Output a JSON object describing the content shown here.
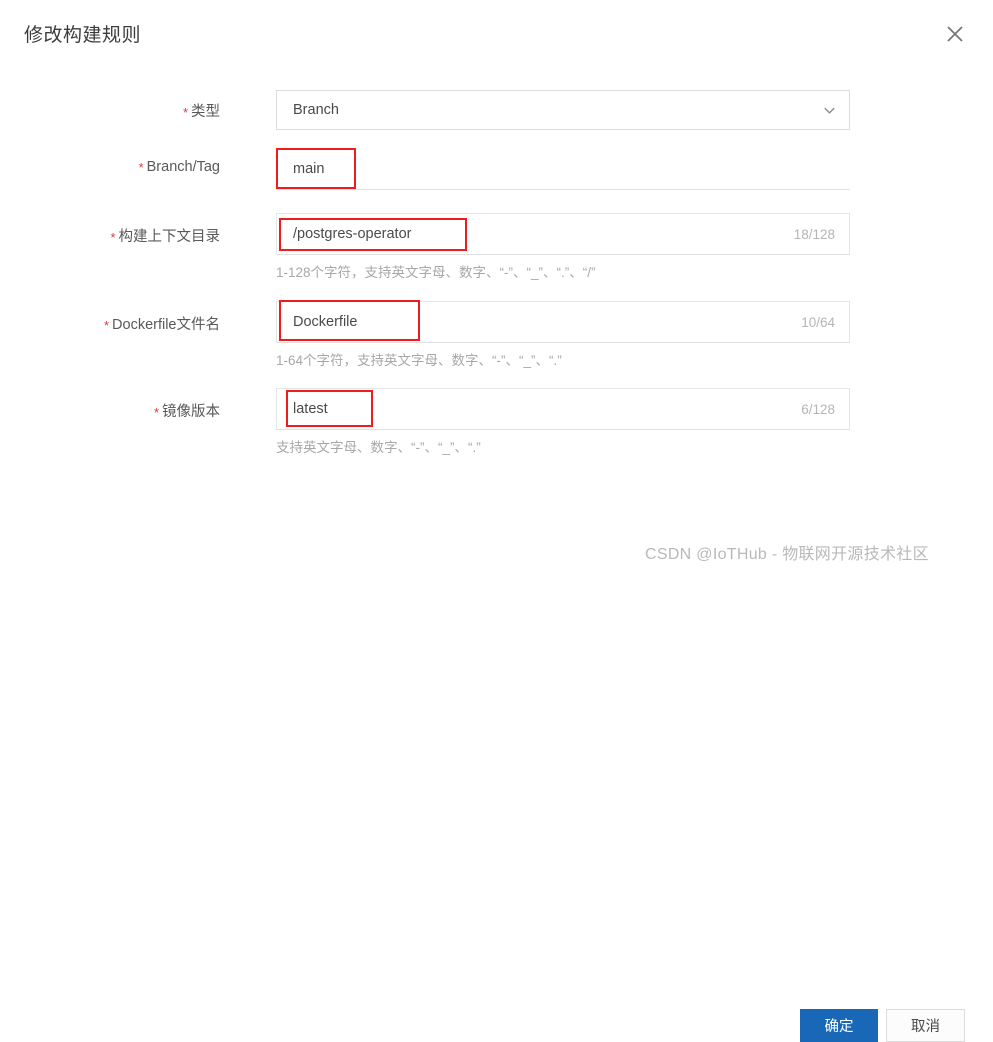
{
  "dialog": {
    "title": "修改构建规则",
    "close_icon": "close-icon"
  },
  "form": {
    "fields": [
      {
        "label": "类型",
        "required_mark": "*",
        "type": "select",
        "value": "Branch",
        "icon": "chevron-down-icon",
        "help": "",
        "counter": ""
      },
      {
        "label": "Branch/Tag",
        "required_mark": "*",
        "type": "text",
        "value": "main",
        "help": "",
        "counter": ""
      },
      {
        "label": "构建上下文目录",
        "required_mark": "*",
        "type": "text",
        "value": "/postgres-operator",
        "counter": "18/128",
        "help": "1-128个字符，支持英文字母、数字、“-”、“_”、“.”、“/”"
      },
      {
        "label": "Dockerfile文件名",
        "required_mark": "*",
        "type": "text",
        "value": "Dockerfile",
        "counter": "10/64",
        "help": "1-64个字符，支持英文字母、数字、“-”、“_”、“.”"
      },
      {
        "label": "镜像版本",
        "required_mark": "*",
        "type": "text",
        "value": "latest",
        "counter": "6/128",
        "help": "支持英文字母、数字、“-”、“_”、“.”"
      }
    ]
  },
  "footer": {
    "confirm_label": "确定",
    "cancel_label": "取消"
  },
  "watermark": {
    "text": "CSDN @IoTHub - 物联网开源技术社区"
  },
  "colors": {
    "primary": "#1868b7",
    "required_star": "#e03b3b",
    "annotation": "#ee1c1c",
    "help_text": "#a8a8a8"
  }
}
